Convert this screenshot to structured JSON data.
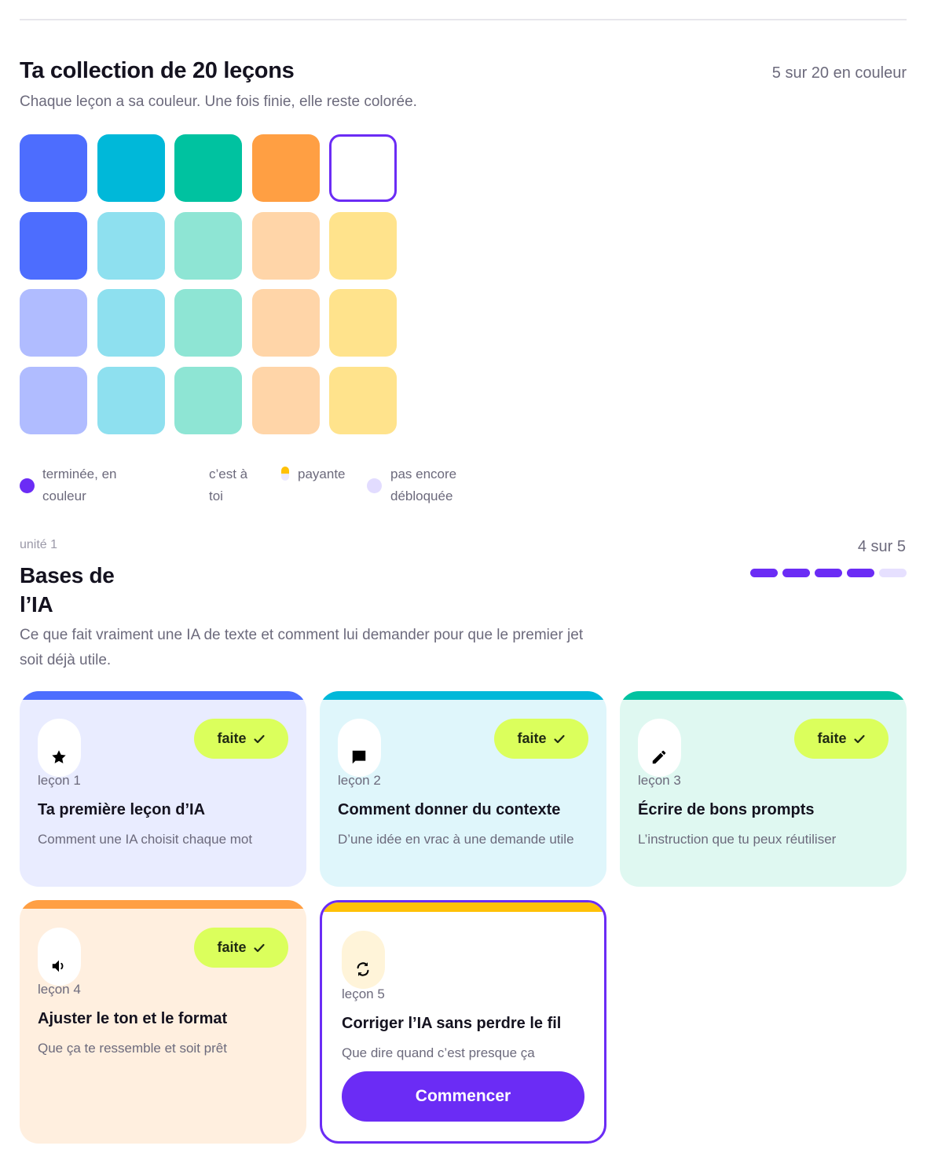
{
  "collection": {
    "title": "Ta collection de 20 leçons",
    "count": "5 sur 20 en couleur",
    "subtitle": "Chaque leçon a sa couleur. Une fois finie, elle reste colorée.",
    "rows": [
      [
        "#4d6dfe",
        "#00b8d9",
        "#00c2a0",
        "#ff9f43",
        "current"
      ],
      [
        "#4d6dfe",
        "#8ee0ef",
        "#8ee5d4",
        "#ffd5a8",
        "#ffe38c"
      ],
      [
        "#b0bcff",
        "#8ee0ef",
        "#8ee5d4",
        "#ffd5a8",
        "#ffe38c"
      ],
      [
        "#b0bcff",
        "#8ee0ef",
        "#8ee5d4",
        "#ffd5a8",
        "#ffe38c"
      ]
    ],
    "accent": "#6b2cf5"
  },
  "legend": {
    "done": "terminée, en couleur",
    "yours": "c’est à toi",
    "paid": "payante",
    "locked": "pas encore débloquée"
  },
  "unit": {
    "label": "unité 1",
    "count": "4 sur 5",
    "title": "Bases de l’IA",
    "description": "Ce que fait vraiment une IA de texte et comment lui demander pour que le premier jet soit déjà utile.",
    "progress_done": 4,
    "progress_total": 5
  },
  "lessons": [
    {
      "number": "leçon 1",
      "title": "Ta première leçon d’IA",
      "desc": "Comment une IA choisit chaque mot",
      "badge": "faite",
      "icon": "star-icon",
      "band": "#4d6dfe",
      "bg": "#e9ecff"
    },
    {
      "number": "leçon 2",
      "title": "Comment donner du contexte",
      "desc": "D’une idée en vrac à une demande utile",
      "badge": "faite",
      "icon": "chat-icon",
      "band": "#00b8d9",
      "bg": "#dff6fb"
    },
    {
      "number": "leçon 3",
      "title": "Écrire de bons prompts",
      "desc": "L’instruction que tu peux réutiliser",
      "badge": "faite",
      "icon": "pencil-icon",
      "band": "#00c2a0",
      "bg": "#dff8f1"
    },
    {
      "number": "leçon 4",
      "title": "Ajuster le ton et le format",
      "desc": "Que ça te ressemble et soit prêt",
      "badge": "faite",
      "icon": "speaker-icon",
      "band": "#ff9f43",
      "bg": "#ffefdf"
    },
    {
      "number": "leçon 5",
      "title": "Corriger l’IA sans perdre le fil",
      "desc": "Que dire quand c’est presque ça",
      "icon": "refresh-icon",
      "band": "#ffc107",
      "button": "Commencer"
    }
  ]
}
